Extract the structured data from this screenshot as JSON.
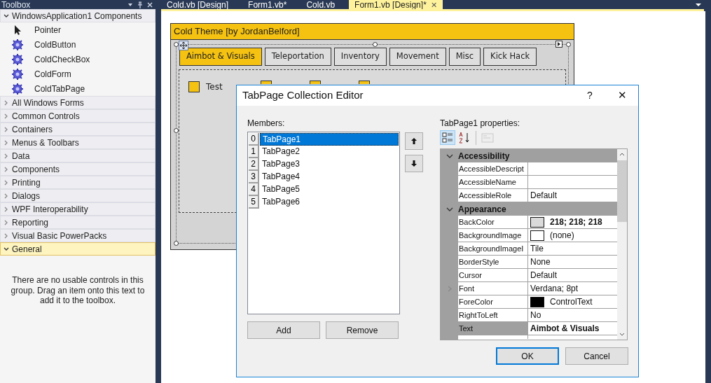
{
  "toolbox": {
    "title": "Toolbox",
    "groups": [
      {
        "label": "WindowsApplication1 Components",
        "expanded": true,
        "selected": false,
        "items": [
          {
            "label": "Pointer",
            "kind": "pointer"
          },
          {
            "label": "ColdButton",
            "kind": "component"
          },
          {
            "label": "ColdCheckBox",
            "kind": "component"
          },
          {
            "label": "ColdForm",
            "kind": "component"
          },
          {
            "label": "ColdTabPage",
            "kind": "component"
          }
        ]
      },
      {
        "label": "All Windows Forms",
        "expanded": false,
        "selected": false
      },
      {
        "label": "Common Controls",
        "expanded": false,
        "selected": false
      },
      {
        "label": "Containers",
        "expanded": false,
        "selected": false
      },
      {
        "label": "Menus & Toolbars",
        "expanded": false,
        "selected": false
      },
      {
        "label": "Data",
        "expanded": false,
        "selected": false
      },
      {
        "label": "Components",
        "expanded": false,
        "selected": false
      },
      {
        "label": "Printing",
        "expanded": false,
        "selected": false
      },
      {
        "label": "Dialogs",
        "expanded": false,
        "selected": false
      },
      {
        "label": "WPF Interoperability",
        "expanded": false,
        "selected": false
      },
      {
        "label": "Reporting",
        "expanded": false,
        "selected": false
      },
      {
        "label": "Visual Basic PowerPacks",
        "expanded": false,
        "selected": false
      },
      {
        "label": "General",
        "expanded": true,
        "selected": true,
        "message": "There are no usable controls in this group. Drag an item onto this text to add it to the toolbox."
      }
    ]
  },
  "document_tabs": [
    {
      "label": "Cold.vb [Design]",
      "selected": false
    },
    {
      "label": "Form1.vb*",
      "selected": false
    },
    {
      "label": "Cold.vb",
      "selected": false
    },
    {
      "label": "Form1.vb [Design]*",
      "selected": true,
      "close": "✕"
    }
  ],
  "form": {
    "title": "Cold Theme [by JordanBelford]",
    "tabs": [
      {
        "label": "Aimbot & Visuals",
        "selected": true
      },
      {
        "label": "Teleportation",
        "selected": false
      },
      {
        "label": "Inventory",
        "selected": false
      },
      {
        "label": "Movement",
        "selected": false
      },
      {
        "label": "Misc",
        "selected": false
      },
      {
        "label": "Kick Hack",
        "selected": false
      }
    ],
    "checkboxes": [
      {
        "label": "Test",
        "kind": "full",
        "checked": false
      },
      {
        "kind": "partial",
        "checked": false
      },
      {
        "kind": "partial",
        "checked": false
      },
      {
        "kind": "partial",
        "checked": false
      }
    ]
  },
  "dialog": {
    "title": "TabPage Collection Editor",
    "help": "?",
    "close": "✕",
    "members_label": "Members:",
    "members": [
      {
        "index": "0",
        "name": "TabPage1",
        "selected": true
      },
      {
        "index": "1",
        "name": "TabPage2",
        "selected": false
      },
      {
        "index": "2",
        "name": "TabPage3",
        "selected": false
      },
      {
        "index": "3",
        "name": "TabPage4",
        "selected": false
      },
      {
        "index": "4",
        "name": "TabPage5",
        "selected": false
      },
      {
        "index": "5",
        "name": "TabPage6",
        "selected": false
      }
    ],
    "add_button": "Add",
    "remove_button": "Remove",
    "properties_label": "TabPage1 properties:",
    "toolbar": [
      {
        "kind": "categorized",
        "selected": true,
        "disabled": false
      },
      {
        "kind": "alphabetical",
        "selected": false,
        "disabled": false
      },
      {
        "kind": "pages",
        "selected": false,
        "disabled": true
      }
    ],
    "categories": [
      {
        "name": "Accessibility",
        "expanded": true,
        "properties": [
          {
            "name": "AccessibleDescript"
          },
          {
            "name": "AccessibleName"
          },
          {
            "name": "AccessibleRole",
            "value": "Default"
          }
        ]
      },
      {
        "name": "Appearance",
        "expanded": true,
        "properties": [
          {
            "name": "BackColor",
            "value": "218; 218; 218",
            "color": "#dadada",
            "bold": true
          },
          {
            "name": "BackgroundImage",
            "value": "(none)",
            "color": "#ffffff"
          },
          {
            "name": "BackgroundImageI",
            "value": "Tile"
          },
          {
            "name": "BorderStyle",
            "value": "None"
          },
          {
            "name": "Cursor",
            "value": "Default"
          },
          {
            "name": "Font",
            "value": "Verdana; 8pt",
            "expandable": true
          },
          {
            "name": "ForeColor",
            "value": "ControlText",
            "color": "#000000"
          },
          {
            "name": "RightToLeft",
            "value": "No"
          },
          {
            "name": "Text",
            "value": "Aimbot & Visuals",
            "bold": true,
            "selected": true
          }
        ]
      }
    ],
    "ok_button": "OK",
    "cancel_button": "Cancel"
  }
}
